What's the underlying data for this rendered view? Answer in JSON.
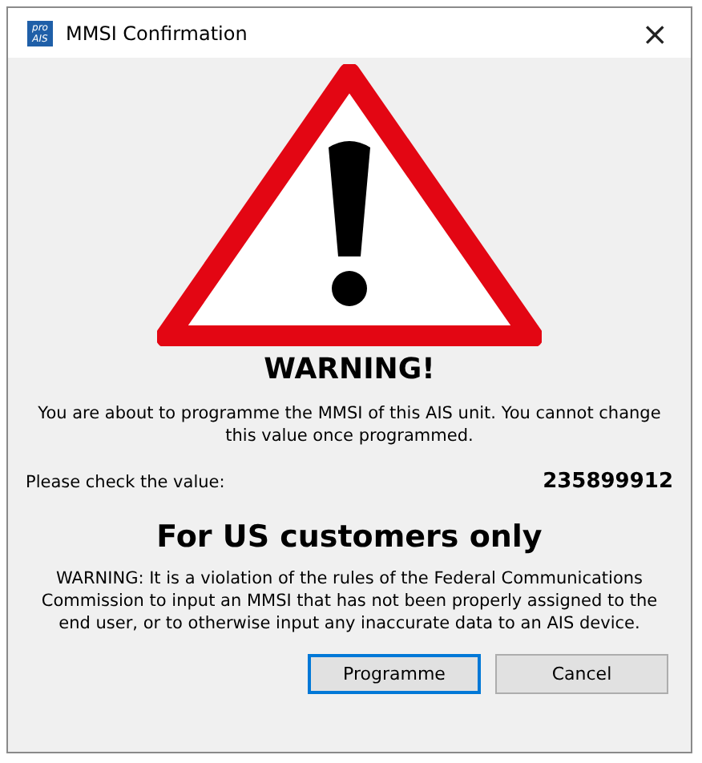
{
  "window": {
    "title": "MMSI Confirmation",
    "icon_text": [
      "pro",
      "AIS"
    ],
    "close": "×"
  },
  "heading": "WARNING!",
  "message": "You are about to programme the MMSI of this AIS unit. You cannot change this value once programmed.",
  "check": {
    "label": "Please check the value:",
    "value": "235899912"
  },
  "notice": "For US customers only",
  "legal": "WARNING: It is a violation of the rules of the Federal Communications Commission to input an MMSI that has not been properly assigned to the end user, or to otherwise input any inaccurate data to an AIS device.",
  "buttons": [
    {
      "label": "Programme",
      "selected": true
    },
    {
      "label": "Cancel",
      "selected": false
    }
  ]
}
